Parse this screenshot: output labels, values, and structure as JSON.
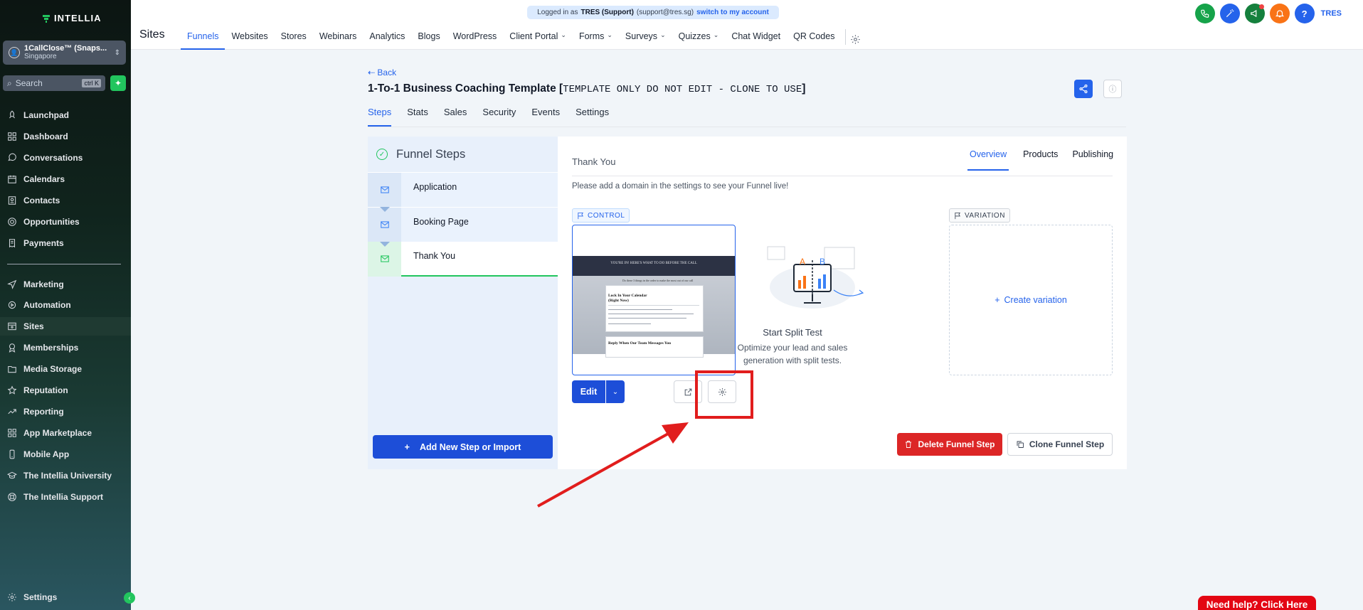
{
  "brand": {
    "logo_text": "INTELLIA"
  },
  "account": {
    "name": "1CallClose™ (Snaps...",
    "location": "Singapore"
  },
  "sidebar_search": {
    "placeholder": "Search",
    "shortcut": "ctrl K"
  },
  "sidebar": {
    "items": [
      {
        "label": "Launchpad",
        "icon": "rocket-icon"
      },
      {
        "label": "Dashboard",
        "icon": "grid-icon"
      },
      {
        "label": "Conversations",
        "icon": "chat-icon"
      },
      {
        "label": "Calendars",
        "icon": "calendar-icon"
      },
      {
        "label": "Contacts",
        "icon": "contacts-icon"
      },
      {
        "label": "Opportunities",
        "icon": "target-icon"
      },
      {
        "label": "Payments",
        "icon": "receipt-icon"
      }
    ],
    "items2": [
      {
        "label": "Marketing",
        "icon": "send-icon"
      },
      {
        "label": "Automation",
        "icon": "automation-icon"
      },
      {
        "label": "Sites",
        "icon": "sites-icon",
        "active": true
      },
      {
        "label": "Memberships",
        "icon": "award-icon"
      },
      {
        "label": "Media Storage",
        "icon": "folder-icon"
      },
      {
        "label": "Reputation",
        "icon": "star-icon"
      },
      {
        "label": "Reporting",
        "icon": "trend-icon"
      },
      {
        "label": "App Marketplace",
        "icon": "apps-icon"
      },
      {
        "label": "Mobile App",
        "icon": "mobile-icon"
      },
      {
        "label": "The Intellia University",
        "icon": "graduation-icon"
      },
      {
        "label": "The Intellia Support",
        "icon": "support-icon"
      }
    ],
    "settings_label": "Settings"
  },
  "banner": {
    "prefix": "Logged in as",
    "user": "TRES (Support)",
    "email": "(support@tres.sg)",
    "switch_label": "switch to my account"
  },
  "header": {
    "section_title": "Sites",
    "nav": [
      {
        "label": "Funnels",
        "active": true
      },
      {
        "label": "Websites"
      },
      {
        "label": "Stores"
      },
      {
        "label": "Webinars"
      },
      {
        "label": "Analytics"
      },
      {
        "label": "Blogs"
      },
      {
        "label": "WordPress"
      },
      {
        "label": "Client Portal",
        "dropdown": true
      },
      {
        "label": "Forms",
        "dropdown": true
      },
      {
        "label": "Surveys",
        "dropdown": true
      },
      {
        "label": "Quizzes",
        "dropdown": true
      },
      {
        "label": "Chat Widget"
      },
      {
        "label": "QR Codes"
      }
    ],
    "user_initials": "TRES",
    "icon_colors": {
      "phone": "#16a34a",
      "magic": "#2563eb",
      "megaphone": "#15803d",
      "bell": "#f97316",
      "help": "#2563eb"
    }
  },
  "page": {
    "back_label": "Back",
    "title": "1-To-1 Business Coaching Template [",
    "title_mono": "TEMPLATE ONLY DO NOT EDIT - CLONE TO USE",
    "title_end": "]",
    "tabs": [
      "Steps",
      "Stats",
      "Sales",
      "Security",
      "Events",
      "Settings"
    ]
  },
  "steps_panel": {
    "heading": "Funnel Steps",
    "steps": [
      "Application",
      "Booking Page",
      "Thank You"
    ],
    "selected": "Thank You",
    "add_button": "Add New Step or Import"
  },
  "step_detail": {
    "title": "Thank You",
    "tabs": [
      "Overview",
      "Products",
      "Publishing"
    ],
    "domain_notice": "Please add a domain in the settings to see your Funnel live!",
    "control_label": "CONTROL",
    "variation_label": "VARIATION",
    "thumbnail": {
      "banner": "YOU'RE IN! HERE'S WHAT TO DO BEFORE THE CALL",
      "sub": "Lock In Your Calendar",
      "sub2": "(Right Now)",
      "item2": "Reply When Our Team Messages You",
      "intro": "Do these 3 things in the order to make the most out of our call"
    },
    "edit_label": "Edit",
    "split_title": "Start Split Test",
    "split_sub": "Optimize your lead and sales generation with split tests.",
    "create_variation": "Create variation",
    "delete_label": "Delete Funnel Step",
    "clone_label": "Clone Funnel Step",
    "illustration_letters": [
      "A",
      "B"
    ]
  },
  "help_button": "Need help? Click Here",
  "accent_colors": {
    "primary": "#2563eb",
    "success": "#22c55e",
    "danger": "#dc2626",
    "annotation": "#e11d1d"
  }
}
